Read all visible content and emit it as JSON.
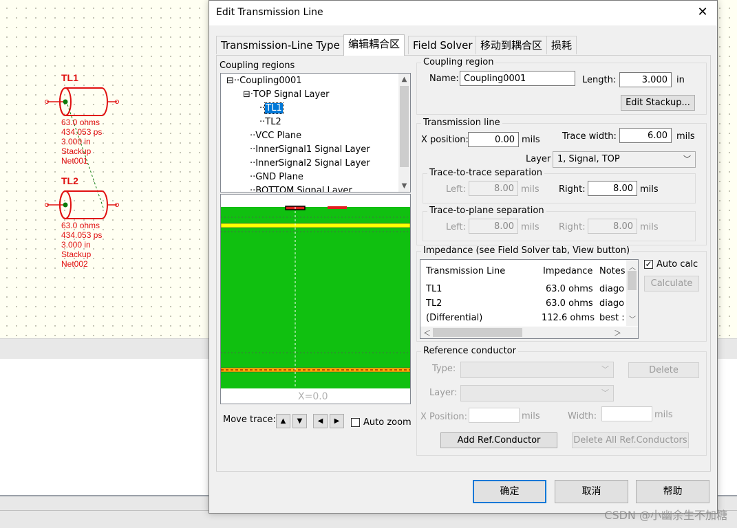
{
  "dialog": {
    "title": "Edit Transmission Line",
    "tabs": [
      "Transmission-Line Type",
      "编辑耦合区",
      "Field Solver",
      "移动到耦合区",
      "损耗"
    ],
    "active_tab": "编辑耦合区"
  },
  "coupling_regions": {
    "label": "Coupling regions",
    "items": [
      "Coupling0001",
      "TOP Signal Layer",
      "TL1",
      "TL2",
      "VCC Plane",
      "InnerSignal1 Signal Layer",
      "InnerSignal2 Signal Layer",
      "GND Plane",
      "BOTTOM Signal Layer"
    ],
    "selected": "TL1"
  },
  "cross_section": {
    "x_label": "X=0.0",
    "colors": {
      "dielectric": "#10c010",
      "plane": "#ffff00",
      "trace_red": "#e02020"
    }
  },
  "move_trace": {
    "label": "Move trace:",
    "auto_zoom_label": "Auto zoom",
    "auto_zoom_checked": false
  },
  "coupling_region": {
    "group": "Coupling region",
    "name_label": "Name:",
    "name_value": "Coupling0001",
    "length_label": "Length:",
    "length_value": "3.000",
    "length_unit": "in",
    "edit_stackup": "Edit Stackup..."
  },
  "transmission_line": {
    "group": "Transmission line",
    "x_position_label": "X position:",
    "x_position_value": "0.00",
    "x_unit": "mils",
    "trace_width_label": "Trace width:",
    "trace_width_value": "6.00",
    "width_unit": "mils",
    "layer_label": "Layer",
    "layer_value": "1, Signal, TOP",
    "t2t": {
      "group": "Trace-to-trace separation",
      "left_label": "Left:",
      "left_value": "8.00",
      "right_label": "Right:",
      "right_value": "8.00",
      "unit": "mils"
    },
    "t2p": {
      "group": "Trace-to-plane separation",
      "left_label": "Left:",
      "left_value": "8.00",
      "right_label": "Right:",
      "right_value": "8.00",
      "unit": "mils"
    }
  },
  "impedance": {
    "group": "Impedance (see Field Solver tab, View button)",
    "columns": [
      "Transmission Line",
      "Impedance",
      "Notes"
    ],
    "rows": [
      {
        "line": "TL1",
        "impedance": "63.0 ohms",
        "notes": "diago"
      },
      {
        "line": "TL2",
        "impedance": "63.0 ohms",
        "notes": "diago"
      },
      {
        "line": "(Differential)",
        "impedance": "112.6 ohms",
        "notes": "best :"
      }
    ],
    "auto_calc_label": "Auto calc",
    "auto_calc_checked": true,
    "calculate": "Calculate"
  },
  "reference_conductor": {
    "group": "Reference conductor",
    "type_label": "Type:",
    "layer_label": "Layer:",
    "xpos_label": "X Position:",
    "xpos_unit": "mils",
    "width_label": "Width:",
    "width_unit": "mils",
    "delete": "Delete",
    "add": "Add Ref.Conductor",
    "delete_all": "Delete All Ref.Conductors"
  },
  "footer": {
    "ok": "确定",
    "cancel": "取消",
    "help": "帮助"
  },
  "schematic": {
    "tl1": {
      "name": "TL1",
      "lines": [
        "63.0 ohms",
        "434.053 ps",
        "3.000 in",
        "Stackup",
        "Net001"
      ]
    },
    "tl2": {
      "name": "TL2",
      "lines": [
        "63.0 ohms",
        "434.053 ps",
        "3.000 in",
        "Stackup",
        "Net002"
      ]
    },
    "color": "#e01010"
  },
  "watermark": "CSDN @小幽余生不加糖"
}
